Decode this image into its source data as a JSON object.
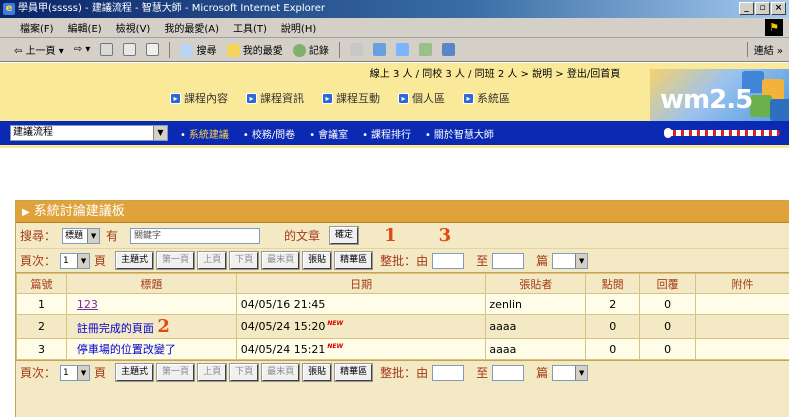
{
  "window": {
    "title": "學員甲(sssss) - 建議流程 - 智慧大師 - Microsoft Internet Explorer",
    "buttons": [
      "_",
      "▫",
      "×"
    ]
  },
  "menu": {
    "items": [
      "檔案(F)",
      "編輯(E)",
      "檢視(V)",
      "我的最愛(A)",
      "工具(T)",
      "說明(H)"
    ]
  },
  "toolbar": {
    "back": "上一頁",
    "search": "搜尋",
    "favorites": "我的最愛",
    "history": "記錄",
    "links": "連結"
  },
  "header": {
    "status": "線上 3 人 / 同校 3 人 / 同班 2 人 > 說明 > 登出/回首頁",
    "nav": [
      "課程內容",
      "課程資訊",
      "課程互動",
      "個人區",
      "系統區"
    ],
    "logo": "wm2.5"
  },
  "nav_strip": {
    "course": "建議流程",
    "links": [
      "系統建議",
      "校務/問卷",
      "會議室",
      "課程排行",
      "關於智慧大師"
    ]
  },
  "board": {
    "title": "系統討論建議板",
    "search": {
      "label": "搜尋：",
      "field": "標題",
      "has": "有",
      "placeholder": "關鍵字",
      "suffix": "的文章",
      "submit": "確定"
    },
    "annotations": {
      "a1": "1",
      "a2": "2",
      "a3": "3"
    },
    "pager": {
      "label": "頁次：",
      "page": "1",
      "unit": "頁",
      "buttons": [
        "主題式",
        "第一頁",
        "上頁",
        "下頁",
        "最末頁",
        "張貼",
        "精華區"
      ],
      "batch": "整批：由",
      "to": "至",
      "action": "篇"
    },
    "columns": [
      "篇號",
      "標題",
      "日期",
      "張貼者",
      "點閱",
      "回覆",
      "附件"
    ],
    "rows": [
      {
        "no": "1",
        "title": "123",
        "date": "04/05/16 21:45",
        "new": "",
        "poster": "zenlin",
        "views": "2",
        "replies": "0"
      },
      {
        "no": "2",
        "title": "註冊完成的頁面",
        "date": "04/05/24 15:20",
        "new": "NEW",
        "poster": "aaaa",
        "views": "0",
        "replies": "0"
      },
      {
        "no": "3",
        "title": "停車場的位置改變了",
        "date": "04/05/24 15:21",
        "new": "NEW",
        "poster": "aaaa",
        "views": "0",
        "replies": "0"
      }
    ]
  }
}
